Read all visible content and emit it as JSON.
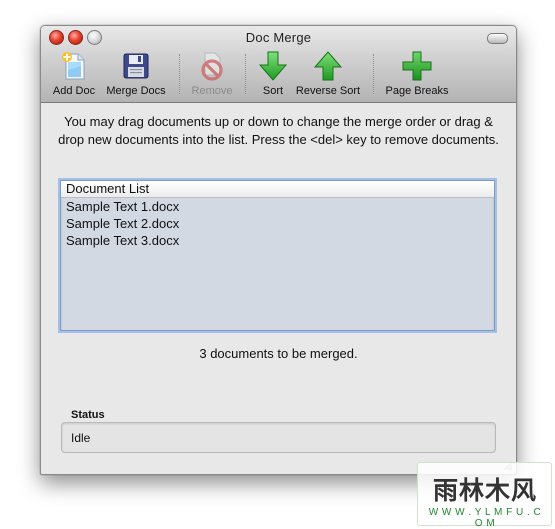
{
  "window": {
    "title": "Doc Merge"
  },
  "toolbar": {
    "items": [
      {
        "label": "Add Doc",
        "icon": "add-doc-icon",
        "enabled": true
      },
      {
        "label": "Merge Docs",
        "icon": "floppy-disk-icon",
        "enabled": true
      },
      {
        "label": "Remove",
        "icon": "no-entry-icon",
        "enabled": false
      },
      {
        "label": "Sort",
        "icon": "green-down-arrow-icon",
        "enabled": true
      },
      {
        "label": "Reverse Sort",
        "icon": "green-up-arrow-icon",
        "enabled": true
      },
      {
        "label": "Page Breaks",
        "icon": "green-plus-icon",
        "enabled": true
      }
    ]
  },
  "instructions": "You may drag documents up or down to change the merge order or drag & drop new documents into the list. Press the <del> key to remove documents.",
  "document_list": {
    "header": "Document List",
    "items": [
      "Sample Text 1.docx",
      "Sample Text 2.docx",
      "Sample Text 3.docx"
    ]
  },
  "summary": "3 documents to be merged.",
  "status": {
    "label": "Status",
    "value": "Idle"
  },
  "watermark": {
    "main": "雨林木风",
    "sub": "W W W . Y L M F U . C O M"
  },
  "colors": {
    "list_background": "#d3d9e3",
    "list_focus_ring": "#a4c0e6",
    "arrow_green": "#2fb52f"
  }
}
